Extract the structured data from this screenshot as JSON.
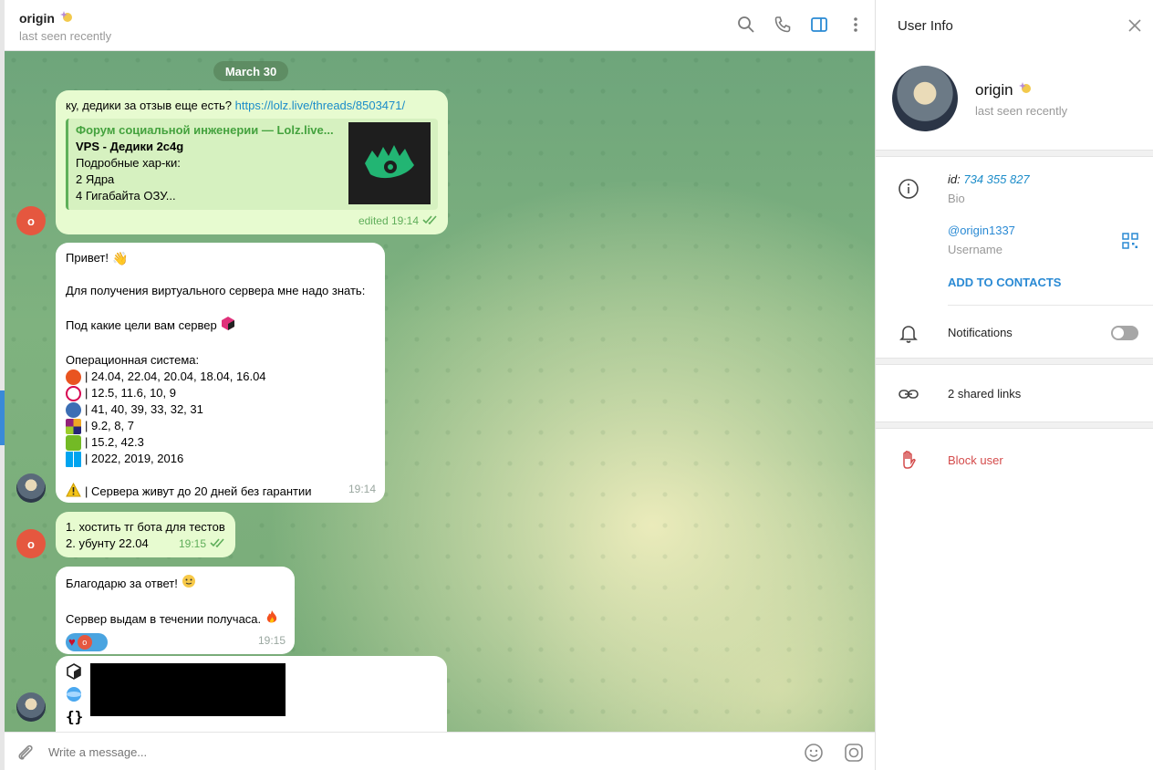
{
  "header": {
    "name": "origin",
    "status": "last seen recently"
  },
  "chat": {
    "date": "March 30",
    "messages": {
      "m1": {
        "text": "ку, дедики за отзыв еще есть?",
        "link": "https://lolz.live/threads/8503471/",
        "preview_site": "Форум социальной инженерии —  Lolz.live...",
        "preview_title": "VPS - Дедики 2c4g",
        "preview_lines": [
          "Подробные хар-ки:",
          "2 Ядра",
          "4 Гигабайта ОЗУ..."
        ],
        "time": "edited 19:14"
      },
      "m2": {
        "greeting": "Привет!",
        "line1": "Для получения виртуального сервера мне надо знать:",
        "line2": "Под какие цели вам сервер",
        "os_title": "Операционная система:",
        "os": [
          {
            "versions": "| 24.04, 22.04, 20.04, 18.04, 16.04",
            "icon": "ubuntu-icon",
            "color": "#e95420"
          },
          {
            "versions": "| 12.5, 11.6, 10, 9",
            "icon": "debian-icon",
            "color": "#d70751"
          },
          {
            "versions": "| 41, 40, 39, 33, 32, 31",
            "icon": "fedora-icon",
            "color": "#3c6eb4"
          },
          {
            "versions": "| 9.2, 8, 7",
            "icon": "centos-icon",
            "color": "#9b4f96"
          },
          {
            "versions": "| 15.2, 42.3",
            "icon": "opensuse-icon",
            "color": "#73ba25"
          },
          {
            "versions": "| 2022, 2019, 2016",
            "icon": "windows-icon",
            "color": "#00a4ef"
          }
        ],
        "warning": "| Сервера живут до 20 дней без гарантии",
        "time": "19:14"
      },
      "m3": {
        "line1": "1. хостить тг бота для тестов",
        "line2": "2. убунту 22.04",
        "time": "19:15"
      },
      "m4": {
        "line1": "Благодарю за ответ!",
        "line2": "Сервер выдам в течении получаса.",
        "reaction_user": "o",
        "time": "19:15"
      }
    },
    "avatar_letter": "o"
  },
  "composer": {
    "placeholder": "Write a message..."
  },
  "info": {
    "title": "User Info",
    "name": "origin",
    "status": "last seen recently",
    "id_label": "id:",
    "id_value": "734 355 827",
    "bio_label": "Bio",
    "username": "@origin1337",
    "username_label": "Username",
    "add_contacts": "ADD TO CONTACTS",
    "notifications": "Notifications",
    "shared_links": "2 shared links",
    "block": "Block user"
  },
  "colors": {
    "accent": "#2a8ad4",
    "outgoing_bubble": "#e7fbd0",
    "danger": "#d44b4b"
  }
}
